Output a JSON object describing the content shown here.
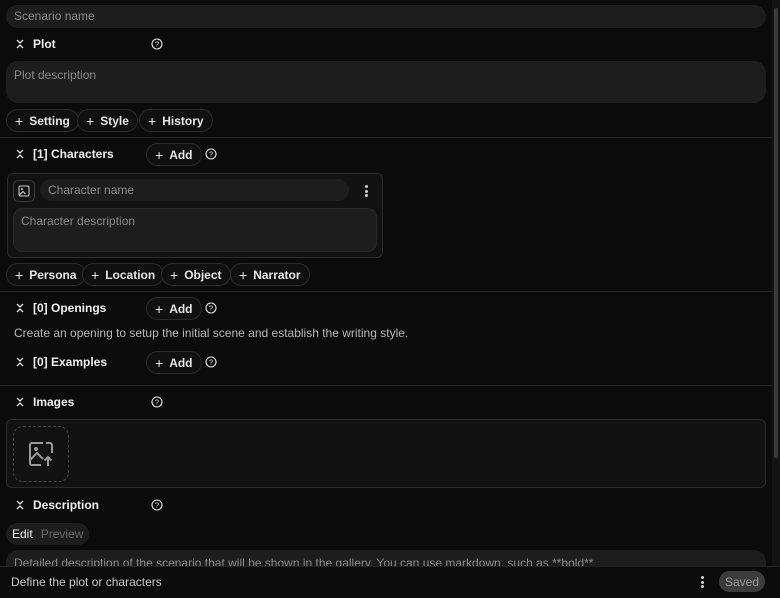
{
  "scenario": {
    "name_placeholder": "Scenario name"
  },
  "plot": {
    "title": "Plot",
    "description_placeholder": "Plot description",
    "chips": [
      "Setting",
      "Style",
      "History"
    ]
  },
  "characters": {
    "title": "[1] Characters",
    "add_label": "Add",
    "card": {
      "name_placeholder": "Character name",
      "description_placeholder": "Character description"
    },
    "chips": [
      "Persona",
      "Location",
      "Object",
      "Narrator"
    ]
  },
  "openings": {
    "title": "[0] Openings",
    "add_label": "Add",
    "hint": "Create an opening to setup the initial scene and establish the writing style."
  },
  "examples": {
    "title": "[0] Examples",
    "add_label": "Add"
  },
  "images": {
    "title": "Images"
  },
  "description": {
    "title": "Description",
    "tabs": [
      "Edit",
      "Preview"
    ],
    "placeholder": "Detailed description of the scenario that will be shown in the gallery. You can use markdown, such as **bold**"
  },
  "footer": {
    "status_text": "Define the plot or characters",
    "saved_label": "Saved"
  }
}
